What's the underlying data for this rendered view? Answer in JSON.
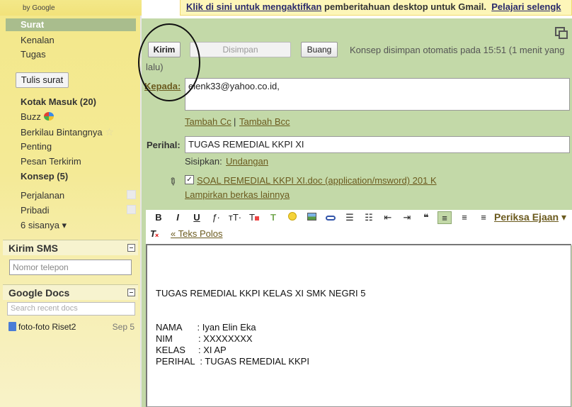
{
  "header": {
    "logo_sub": "by Google",
    "notif_link": "Klik di sini untuk mengaktifkan",
    "notif_text": " pemberitahuan desktop untuk Gmail.",
    "notif_learn": "Pelajari selengk"
  },
  "sidebar": {
    "selected": "Surat",
    "items_top": [
      "Kenalan",
      "Tugas"
    ],
    "compose_label": "Tulis surat",
    "inbox": "Kotak Masuk (20)",
    "buzz": "Buzz",
    "starred": "Berkilau Bintangnya",
    "important": "Penting",
    "sent": "Pesan Terkirim",
    "drafts": "Konsep (5)",
    "label_trip": "Perjalanan",
    "label_personal": "Pribadi",
    "more": "6 sisanya ▾"
  },
  "sms": {
    "title": "Kirim SMS",
    "placeholder": "Nomor telepon"
  },
  "docs": {
    "title": "Google Docs",
    "placeholder": "Search recent docs",
    "doc_name": "foto-foto Riset2",
    "doc_date": "Sep 5"
  },
  "compose": {
    "send": "Kirim",
    "saved": "Disimpan",
    "discard": "Buang",
    "autosave_a": "Konsep disimpan otomatis pada 15:51 (1 menit yang",
    "autosave_b": "lalu)",
    "to_label": "Kepada:",
    "to_value": "elenk33@yahoo.co.id,",
    "add_cc": "Tambah Cc",
    "sep": "|",
    "add_bcc": "Tambah Bcc",
    "subject_label": "Perihal:",
    "subject_value": "TUGAS REMEDIAL KKPI XI",
    "insert_label": "Sisipkan:",
    "insert_link": "Undangan",
    "attachment": "SOAL REMEDIAL KKPI XI.doc (application/msword) 201 K",
    "attach_more": "Lampirkan berkas lainnya",
    "spellcheck": "Periksa Ejaan",
    "plain_text": "« Teks Polos"
  },
  "toolbar": {
    "bold": "B",
    "italic": "I",
    "underline": "U",
    "font": "ƒ·",
    "size": "тT·",
    "quote": "❝"
  },
  "body": {
    "line1": "TUGAS REMEDIAL KKPI KELAS XI SMK NEGRI 5",
    "name": "NAMA      : Iyan Elin Eka",
    "nim": "NIM          : XXXXXXXX",
    "kelas": "KELAS     : XI AP",
    "perihal": "PERIHAL  : TUGAS REMEDIAL KKPI"
  },
  "colors": {
    "compose_bg": "#c3d9a8",
    "sidebar_bg": "#f3e88b",
    "selected_bg": "#a9bd8d"
  }
}
